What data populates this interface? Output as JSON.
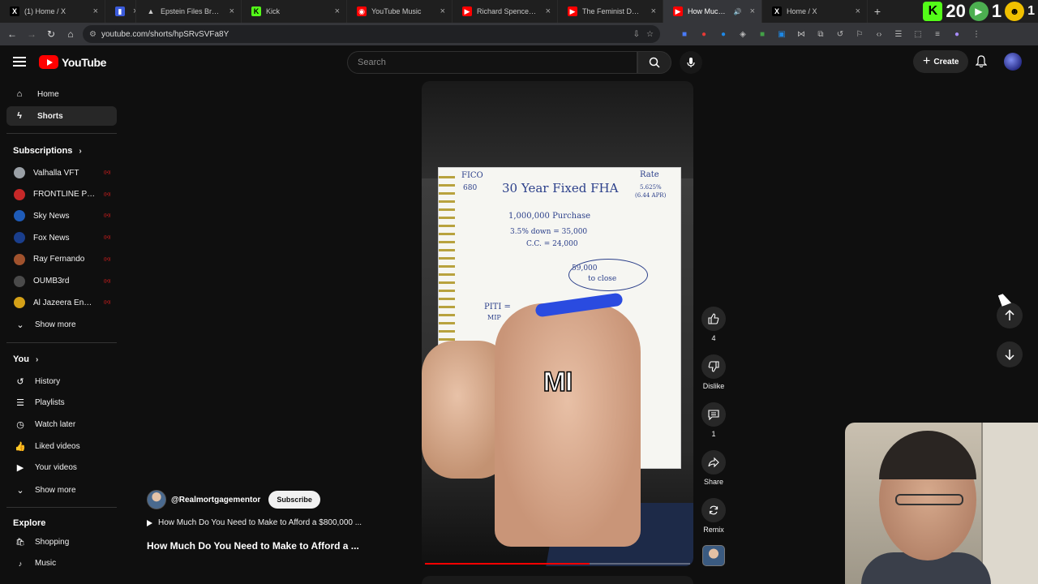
{
  "browser": {
    "tabs": [
      {
        "icon": "x-logo-icon",
        "glyph": "X",
        "title": "(1) Home / X",
        "color": "#000000",
        "fg": "#ffffff",
        "active": false
      },
      {
        "icon": "document-icon",
        "glyph": "▮",
        "title": "",
        "color": "#3b5bdb",
        "fg": "#ffffff",
        "active": false
      },
      {
        "icon": "triangle-icon",
        "glyph": "▲",
        "title": "Epstein Files Browser",
        "color": "transparent",
        "fg": "#cccccc",
        "active": false
      },
      {
        "icon": "kick-logo-icon",
        "glyph": "K",
        "title": "Kick",
        "color": "#53fc18",
        "fg": "#000000",
        "active": false
      },
      {
        "icon": "youtube-music-icon",
        "glyph": "◉",
        "title": "YouTube Music",
        "color": "#ff0000",
        "fg": "#ffffff",
        "active": false
      },
      {
        "icon": "youtube-icon",
        "glyph": "▶",
        "title": "Richard Spencer on Isra",
        "color": "#ff0000",
        "fg": "#ffffff",
        "active": false
      },
      {
        "icon": "youtube-icon",
        "glyph": "▶",
        "title": "The Feminist Debate - Y",
        "color": "#ff0000",
        "fg": "#ffffff",
        "active": false
      },
      {
        "icon": "youtube-icon",
        "glyph": "▶",
        "title": "How Much Do You",
        "color": "#ff0000",
        "fg": "#ffffff",
        "active": true
      },
      {
        "icon": "x-logo-icon",
        "glyph": "X",
        "title": "Home / X",
        "color": "#000000",
        "fg": "#ffffff",
        "active": false
      }
    ],
    "new_tab_label": "+",
    "ext_text_1": "20",
    "ext_text_2": "1",
    "ext_text_3": "1",
    "url": "youtube.com/shorts/hpSRvSVFa8Y"
  },
  "youtube": {
    "logo_text": "YouTube",
    "search_placeholder": "Search",
    "create_label": "Create"
  },
  "sidebar": {
    "home": "Home",
    "shorts": "Shorts",
    "subscriptions_header": "Subscriptions",
    "subscriptions": [
      {
        "name": "Valhalla VFT",
        "color": "#9aa0a6"
      },
      {
        "name": "FRONTLINE PBS ...",
        "color": "#c62828"
      },
      {
        "name": "Sky News",
        "color": "#1e5bb8"
      },
      {
        "name": "Fox News",
        "color": "#1a3e8c"
      },
      {
        "name": "Ray Fernando",
        "color": "#a0522d"
      },
      {
        "name": "OUMB3rd",
        "color": "#4a4a4a"
      },
      {
        "name": "Al Jazeera English",
        "color": "#d4a017"
      }
    ],
    "show_more_1": "Show more",
    "you_header": "You",
    "you_items": [
      {
        "label": "History",
        "icon": "history-icon",
        "glyph": "↺"
      },
      {
        "label": "Playlists",
        "icon": "playlists-icon",
        "glyph": "☰"
      },
      {
        "label": "Watch later",
        "icon": "clock-icon",
        "glyph": "◷"
      },
      {
        "label": "Liked videos",
        "icon": "thumbs-up-icon",
        "glyph": "👍"
      },
      {
        "label": "Your videos",
        "icon": "your-videos-icon",
        "glyph": "▶"
      }
    ],
    "show_more_2": "Show more",
    "explore_header": "Explore",
    "explore_items": [
      {
        "label": "Shopping",
        "icon": "shopping-bag-icon",
        "glyph": "🛍"
      },
      {
        "label": "Music",
        "icon": "music-note-icon",
        "glyph": "♪"
      }
    ]
  },
  "video": {
    "notebook": {
      "fico_label": "FICO",
      "fico_value": "680",
      "title": "30 Year Fixed FHA",
      "rate_label": "Rate",
      "rate_value": "5.625%",
      "apr_value": "(6.44 APR)",
      "purchase": "1,000,000  Purchase",
      "down": "3.5% down = 35,000",
      "cc": "C.C.  = 24,000",
      "total": "59,000",
      "total_note": "to close",
      "piti": "PITI =",
      "mip": "MIP"
    },
    "caption": "MI",
    "progress_fraction": 0.62,
    "channel_handle": "@Realmortgagementor",
    "subscribe_label": "Subscribe",
    "link_text": "How Much Do You Need to Make to Afford a $800,000 ...",
    "title": "How Much Do You Need to Make to Afford a ..."
  },
  "actions": {
    "like_count": "4",
    "dislike_label": "Dislike",
    "comment_count": "1",
    "share_label": "Share",
    "remix_label": "Remix"
  }
}
